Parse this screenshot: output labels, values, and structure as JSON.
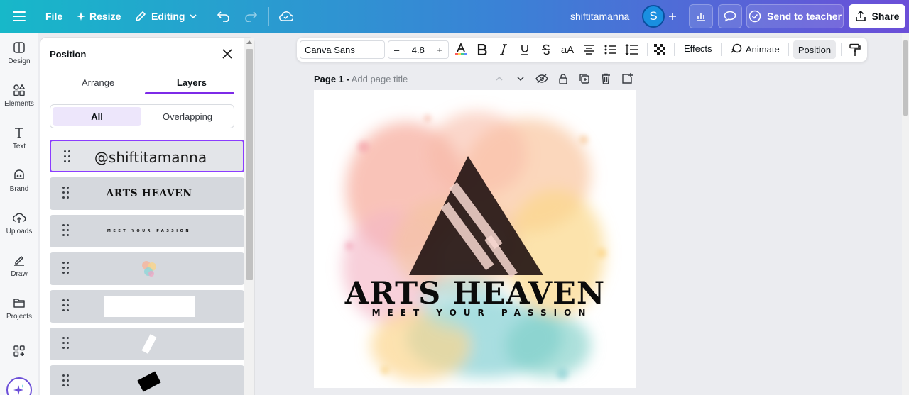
{
  "topbar": {
    "file_label": "File",
    "resize_label": "Resize",
    "editing_label": "Editing",
    "username": "shiftitamanna",
    "avatar_letter": "S",
    "send_label": "Send to teacher",
    "share_label": "Share"
  },
  "rail": {
    "items": [
      {
        "label": "Design",
        "icon": "design-icon"
      },
      {
        "label": "Elements",
        "icon": "elements-icon"
      },
      {
        "label": "Text",
        "icon": "text-icon"
      },
      {
        "label": "Brand",
        "icon": "brand-icon"
      },
      {
        "label": "Uploads",
        "icon": "uploads-icon"
      },
      {
        "label": "Draw",
        "icon": "draw-icon"
      },
      {
        "label": "Projects",
        "icon": "projects-icon"
      }
    ]
  },
  "panel": {
    "title": "Position",
    "tabs": [
      "Arrange",
      "Layers"
    ],
    "active_tab": "Layers",
    "segments": [
      "All",
      "Overlapping"
    ],
    "layers": [
      {
        "type": "text",
        "text": "@shiftitamanna",
        "selected": true
      },
      {
        "type": "text",
        "text": "ARTS HEAVEN"
      },
      {
        "type": "text",
        "text": "MEET YOUR PASSION"
      },
      {
        "type": "image",
        "text": ""
      },
      {
        "type": "shape",
        "text": ""
      },
      {
        "type": "shape",
        "text": ""
      },
      {
        "type": "shape",
        "text": ""
      }
    ]
  },
  "toolbar": {
    "font": "Canva Sans",
    "size": "4.8",
    "minus": "–",
    "plus": "+",
    "effects_label": "Effects",
    "animate_label": "Animate",
    "position_label": "Position",
    "case_label": "aA"
  },
  "page": {
    "label": "Page 1 -",
    "title_placeholder": "Add page title"
  },
  "design": {
    "title": "ARTS HEAVEN",
    "subtitle": "MEET YOUR PASSION"
  },
  "colors": {
    "accent": "#7d2ae8",
    "topbar_start": "#17b8c9",
    "topbar_end": "#6b4ed8"
  }
}
